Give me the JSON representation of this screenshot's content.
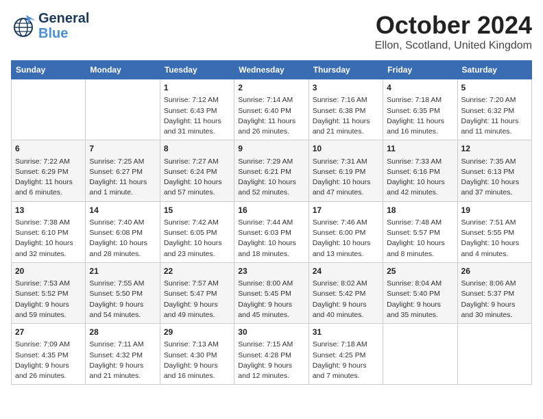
{
  "logo": {
    "line1": "General",
    "line2": "Blue"
  },
  "title": "October 2024",
  "location": "Ellon, Scotland, United Kingdom",
  "headers": [
    "Sunday",
    "Monday",
    "Tuesday",
    "Wednesday",
    "Thursday",
    "Friday",
    "Saturday"
  ],
  "weeks": [
    [
      {
        "day": "",
        "content": ""
      },
      {
        "day": "",
        "content": ""
      },
      {
        "day": "1",
        "content": "Sunrise: 7:12 AM\nSunset: 6:43 PM\nDaylight: 11 hours\nand 31 minutes."
      },
      {
        "day": "2",
        "content": "Sunrise: 7:14 AM\nSunset: 6:40 PM\nDaylight: 11 hours\nand 26 minutes."
      },
      {
        "day": "3",
        "content": "Sunrise: 7:16 AM\nSunset: 6:38 PM\nDaylight: 11 hours\nand 21 minutes."
      },
      {
        "day": "4",
        "content": "Sunrise: 7:18 AM\nSunset: 6:35 PM\nDaylight: 11 hours\nand 16 minutes."
      },
      {
        "day": "5",
        "content": "Sunrise: 7:20 AM\nSunset: 6:32 PM\nDaylight: 11 hours\nand 11 minutes."
      }
    ],
    [
      {
        "day": "6",
        "content": "Sunrise: 7:22 AM\nSunset: 6:29 PM\nDaylight: 11 hours\nand 6 minutes."
      },
      {
        "day": "7",
        "content": "Sunrise: 7:25 AM\nSunset: 6:27 PM\nDaylight: 11 hours\nand 1 minute."
      },
      {
        "day": "8",
        "content": "Sunrise: 7:27 AM\nSunset: 6:24 PM\nDaylight: 10 hours\nand 57 minutes."
      },
      {
        "day": "9",
        "content": "Sunrise: 7:29 AM\nSunset: 6:21 PM\nDaylight: 10 hours\nand 52 minutes."
      },
      {
        "day": "10",
        "content": "Sunrise: 7:31 AM\nSunset: 6:19 PM\nDaylight: 10 hours\nand 47 minutes."
      },
      {
        "day": "11",
        "content": "Sunrise: 7:33 AM\nSunset: 6:16 PM\nDaylight: 10 hours\nand 42 minutes."
      },
      {
        "day": "12",
        "content": "Sunrise: 7:35 AM\nSunset: 6:13 PM\nDaylight: 10 hours\nand 37 minutes."
      }
    ],
    [
      {
        "day": "13",
        "content": "Sunrise: 7:38 AM\nSunset: 6:10 PM\nDaylight: 10 hours\nand 32 minutes."
      },
      {
        "day": "14",
        "content": "Sunrise: 7:40 AM\nSunset: 6:08 PM\nDaylight: 10 hours\nand 28 minutes."
      },
      {
        "day": "15",
        "content": "Sunrise: 7:42 AM\nSunset: 6:05 PM\nDaylight: 10 hours\nand 23 minutes."
      },
      {
        "day": "16",
        "content": "Sunrise: 7:44 AM\nSunset: 6:03 PM\nDaylight: 10 hours\nand 18 minutes."
      },
      {
        "day": "17",
        "content": "Sunrise: 7:46 AM\nSunset: 6:00 PM\nDaylight: 10 hours\nand 13 minutes."
      },
      {
        "day": "18",
        "content": "Sunrise: 7:48 AM\nSunset: 5:57 PM\nDaylight: 10 hours\nand 8 minutes."
      },
      {
        "day": "19",
        "content": "Sunrise: 7:51 AM\nSunset: 5:55 PM\nDaylight: 10 hours\nand 4 minutes."
      }
    ],
    [
      {
        "day": "20",
        "content": "Sunrise: 7:53 AM\nSunset: 5:52 PM\nDaylight: 9 hours\nand 59 minutes."
      },
      {
        "day": "21",
        "content": "Sunrise: 7:55 AM\nSunset: 5:50 PM\nDaylight: 9 hours\nand 54 minutes."
      },
      {
        "day": "22",
        "content": "Sunrise: 7:57 AM\nSunset: 5:47 PM\nDaylight: 9 hours\nand 49 minutes."
      },
      {
        "day": "23",
        "content": "Sunrise: 8:00 AM\nSunset: 5:45 PM\nDaylight: 9 hours\nand 45 minutes."
      },
      {
        "day": "24",
        "content": "Sunrise: 8:02 AM\nSunset: 5:42 PM\nDaylight: 9 hours\nand 40 minutes."
      },
      {
        "day": "25",
        "content": "Sunrise: 8:04 AM\nSunset: 5:40 PM\nDaylight: 9 hours\nand 35 minutes."
      },
      {
        "day": "26",
        "content": "Sunrise: 8:06 AM\nSunset: 5:37 PM\nDaylight: 9 hours\nand 30 minutes."
      }
    ],
    [
      {
        "day": "27",
        "content": "Sunrise: 7:09 AM\nSunset: 4:35 PM\nDaylight: 9 hours\nand 26 minutes."
      },
      {
        "day": "28",
        "content": "Sunrise: 7:11 AM\nSunset: 4:32 PM\nDaylight: 9 hours\nand 21 minutes."
      },
      {
        "day": "29",
        "content": "Sunrise: 7:13 AM\nSunset: 4:30 PM\nDaylight: 9 hours\nand 16 minutes."
      },
      {
        "day": "30",
        "content": "Sunrise: 7:15 AM\nSunset: 4:28 PM\nDaylight: 9 hours\nand 12 minutes."
      },
      {
        "day": "31",
        "content": "Sunrise: 7:18 AM\nSunset: 4:25 PM\nDaylight: 9 hours\nand 7 minutes."
      },
      {
        "day": "",
        "content": ""
      },
      {
        "day": "",
        "content": ""
      }
    ]
  ]
}
